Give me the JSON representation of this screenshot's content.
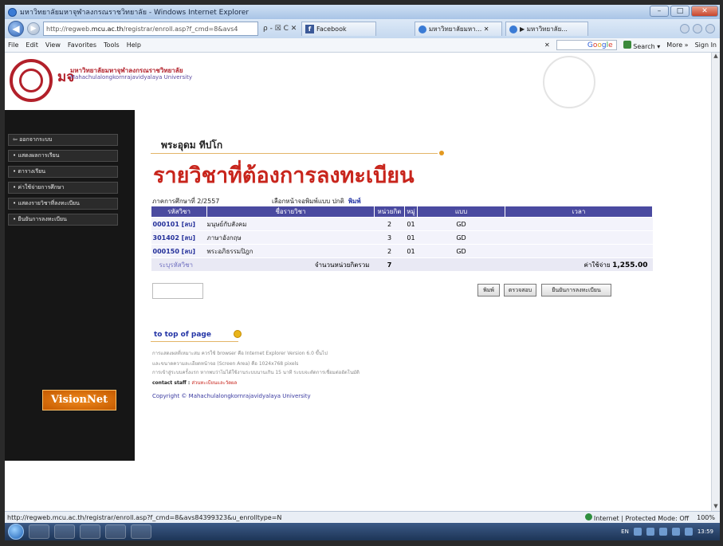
{
  "window": {
    "title": "มหาวิทยาลัยมหาจุฬาลงกรณราชวิทยาลัย - Windows Internet Explorer"
  },
  "addressbar": {
    "url_prefix": "http://regweb.",
    "url_host": "mcu.ac.th",
    "url_path": "/registrar/enroll.asp?f_cmd=8&avs4",
    "url_controls": "ρ - ☒ C ✕",
    "tabs": [
      {
        "label": "Facebook"
      },
      {
        "label": "มหาวิทยาลัยมหา... ✕"
      },
      {
        "label": "▶ มหาวิทยาลัย..."
      }
    ]
  },
  "menubar": {
    "items": [
      "File",
      "Edit",
      "View",
      "Favorites",
      "Tools",
      "Help"
    ],
    "x_label": "✕",
    "search_label": "Search ▾",
    "more_label": "More »",
    "signin_label": "Sign In"
  },
  "header": {
    "logo_mark": "มจ",
    "university_th": "มหาวิทยาลัยมหาจุฬาลงกรณราชวิทยาลัย",
    "university_en": "Mahachulalongkornrajavidyalaya University"
  },
  "sidebar": {
    "items": [
      {
        "label": "⇦ ออกจากระบบ"
      },
      {
        "label": "• แสดงผลการเรียน"
      },
      {
        "label": "• ตารางเรียน"
      },
      {
        "label": "• ค่าใช้จ่ายการศึกษา"
      },
      {
        "label": "• แสดงรายวิชาที่ลงทะเบียน"
      },
      {
        "label": "• ยืนยันการลงทะเบียน"
      }
    ],
    "banner": "VisionNet"
  },
  "main": {
    "student_name": "พระอุดม  ทีปโก",
    "page_title": "รายวิชาที่ต้องการลงทะเบียน",
    "term_label": "ภาคการศึกษาที่  2/2557",
    "print_choice": "เลือกหน้าจอพิมพ์แบบ  ปกติ",
    "print_link": "พิมพ์",
    "columns": [
      "รหัสวิชา",
      "ชื่อรายวิชา",
      "หน่วยกิต",
      "หมู่",
      "แบบ",
      "เวลา"
    ],
    "rows": [
      {
        "code": "000101 [ลบ]",
        "name": "มนุษย์กับสังคม",
        "credits": "2",
        "group": "01",
        "type": "GD",
        "time": ""
      },
      {
        "code": "301402 [ลบ]",
        "name": "ภาษาอังกฤษ",
        "credits": "3",
        "group": "01",
        "type": "GD",
        "time": ""
      },
      {
        "code": "000150 [ลบ]",
        "name": "พระอภิธรรมปิฎก",
        "credits": "2",
        "group": "01",
        "type": "GD",
        "time": ""
      }
    ],
    "add_course_link": "ระบุรหัสวิชา",
    "total_credits_label": "จำนวนหน่วยกิตรวม",
    "total_credits": "7",
    "fee_label": "ค่าใช้จ่าย",
    "fee_value": "1,255.00",
    "buttons": {
      "print": "พิมพ์",
      "check": "ตรวจสอบ",
      "register": "ยืนยันการลงทะเบียน"
    },
    "to_top": "to top of page",
    "footer_lines": [
      "การแสดงผลที่เหมาะสม ควรใช้ browser คือ Internet Explorer Version 6.0 ขึ้นไป",
      "และขนาดความละเอียดหน้าจอ (Screen Area) คือ 1024x768 pixels",
      "การเข้าสู่ระบบครั้งแรก หากพบว่าไม่ได้ใช้งานระบบนานเกิน 15 นาที ระบบจะตัดการเชื่อมต่ออัตโนมัติ"
    ],
    "contact_label": "contact staff :",
    "contact_value": "ส่วนทะเบียนและวัดผล",
    "copyright": "Copyright © Mahachulalongkornrajavidyalaya University"
  },
  "statusbar": {
    "url": "http://regweb.mcu.ac.th/registrar/enroll.asp?f_cmd=8&avs84399323&u_enrolltype=N",
    "zone": "Internet | Protected Mode: Off",
    "zoom": "100%"
  },
  "taskbar": {
    "lang": "EN",
    "clock": "13:59"
  }
}
